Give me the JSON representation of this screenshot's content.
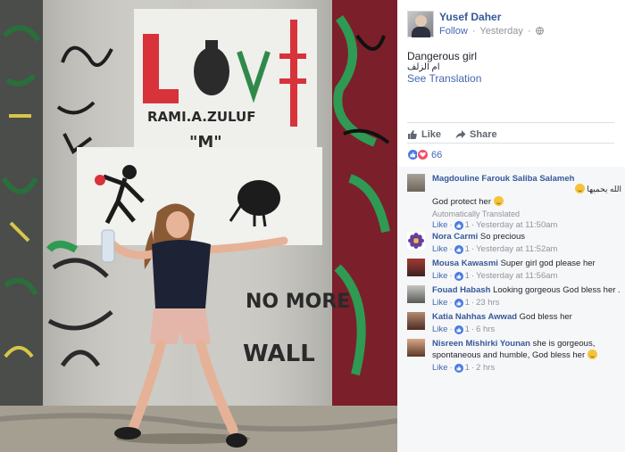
{
  "post": {
    "author": "Yusef Daher",
    "follow_label": "Follow",
    "separator": "·",
    "time": "Yesterday",
    "privacy_icon": "globe-icon",
    "caption": "Dangerous girl",
    "caption_ar": "ام الزلف",
    "see_translation": "See Translation",
    "actions": {
      "like": "Like",
      "share": "Share"
    },
    "reactions_count": "66"
  },
  "photo": {
    "wall_text": {
      "love": "L  V",
      "name": "RAMI.A.ZULUF",
      "m": "\"M\"",
      "graffiti_no_more": "NO MORE",
      "graffiti_wall": "WALL"
    }
  },
  "comments": [
    {
      "name": "Magdouline Farouk Saliba Salameh",
      "arabic": "الله يحميها",
      "text": "God protect her",
      "auto": "Automatically Translated",
      "like": "Like",
      "dot": "·",
      "count": "1",
      "time": "Yesterday at 11:50am"
    },
    {
      "name": "Nora Carmi",
      "text": "So precious",
      "like": "Like",
      "dot": "·",
      "count": "1",
      "time": "Yesterday at 11:52am"
    },
    {
      "name": "Mousa Kawasmi",
      "text": "Super girl god please her",
      "like": "Like",
      "dot": "·",
      "count": "1",
      "time": "Yesterday at 11:56am"
    },
    {
      "name": "Fouad Habash",
      "text": "Looking gorgeous God bless her .",
      "like": "Like",
      "dot": "·",
      "count": "1",
      "time": "23 hrs"
    },
    {
      "name": "Katia Nahhas Awwad",
      "text": "God bless her",
      "like": "Like",
      "dot": "·",
      "count": "1",
      "time": "6 hrs"
    },
    {
      "name": "Nisreen Mishirki Younan",
      "text": "she is gorgeous, spontaneous and humble, God bless her",
      "like": "Like",
      "dot": "·",
      "count": "1",
      "time": "2 hrs"
    }
  ],
  "colors": {
    "link": "#365899",
    "accent": "#4267b2",
    "meta": "#90949c",
    "comment_bg": "#f6f7f9",
    "like_blue": "#4a7ae3",
    "love_red": "#f25268"
  }
}
